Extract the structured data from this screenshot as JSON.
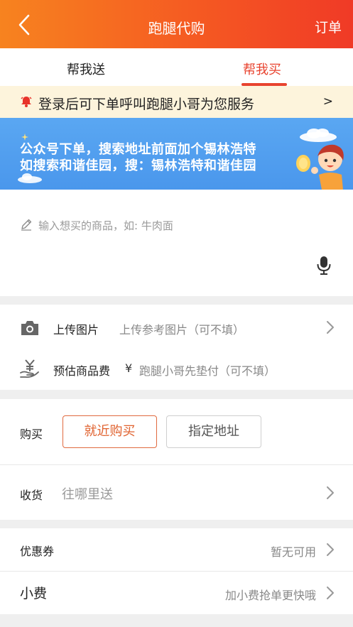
{
  "header": {
    "title": "跑腿代购",
    "order_label": "订单"
  },
  "tabs": [
    {
      "label": "帮我送"
    },
    {
      "label": "帮我买"
    }
  ],
  "notice": {
    "text": "登录后可下单呼叫跑腿小哥为您服务",
    "arrow": ">"
  },
  "banner": {
    "line1": "公众号下单，搜索地址前面加个锡林浩特",
    "line2": "如搜索和谐佳园，搜：锡林浩特和谐佳园"
  },
  "item_input": {
    "placeholder": "输入想买的商品，如: 牛肉面"
  },
  "upload": {
    "label": "上传图片",
    "hint": "上传参考图片（可不填）"
  },
  "estimate": {
    "label": "预估商品费",
    "currency": "¥",
    "hint": "跑腿小哥先垫付（可不填）"
  },
  "buy": {
    "label": "购买",
    "option_nearby": "就近购买",
    "option_address": "指定地址"
  },
  "receive": {
    "label": "收货",
    "placeholder": "往哪里送"
  },
  "coupon": {
    "label": "优惠券",
    "value": "暂无可用"
  },
  "tip": {
    "label": "小费",
    "value": "加小费抢单更快哦"
  },
  "colors": {
    "accent": "#e8432f",
    "header_start": "#f7831f",
    "header_end": "#f03a26",
    "banner": "#4f9cee",
    "notice_bg": "#fdf4dc"
  }
}
